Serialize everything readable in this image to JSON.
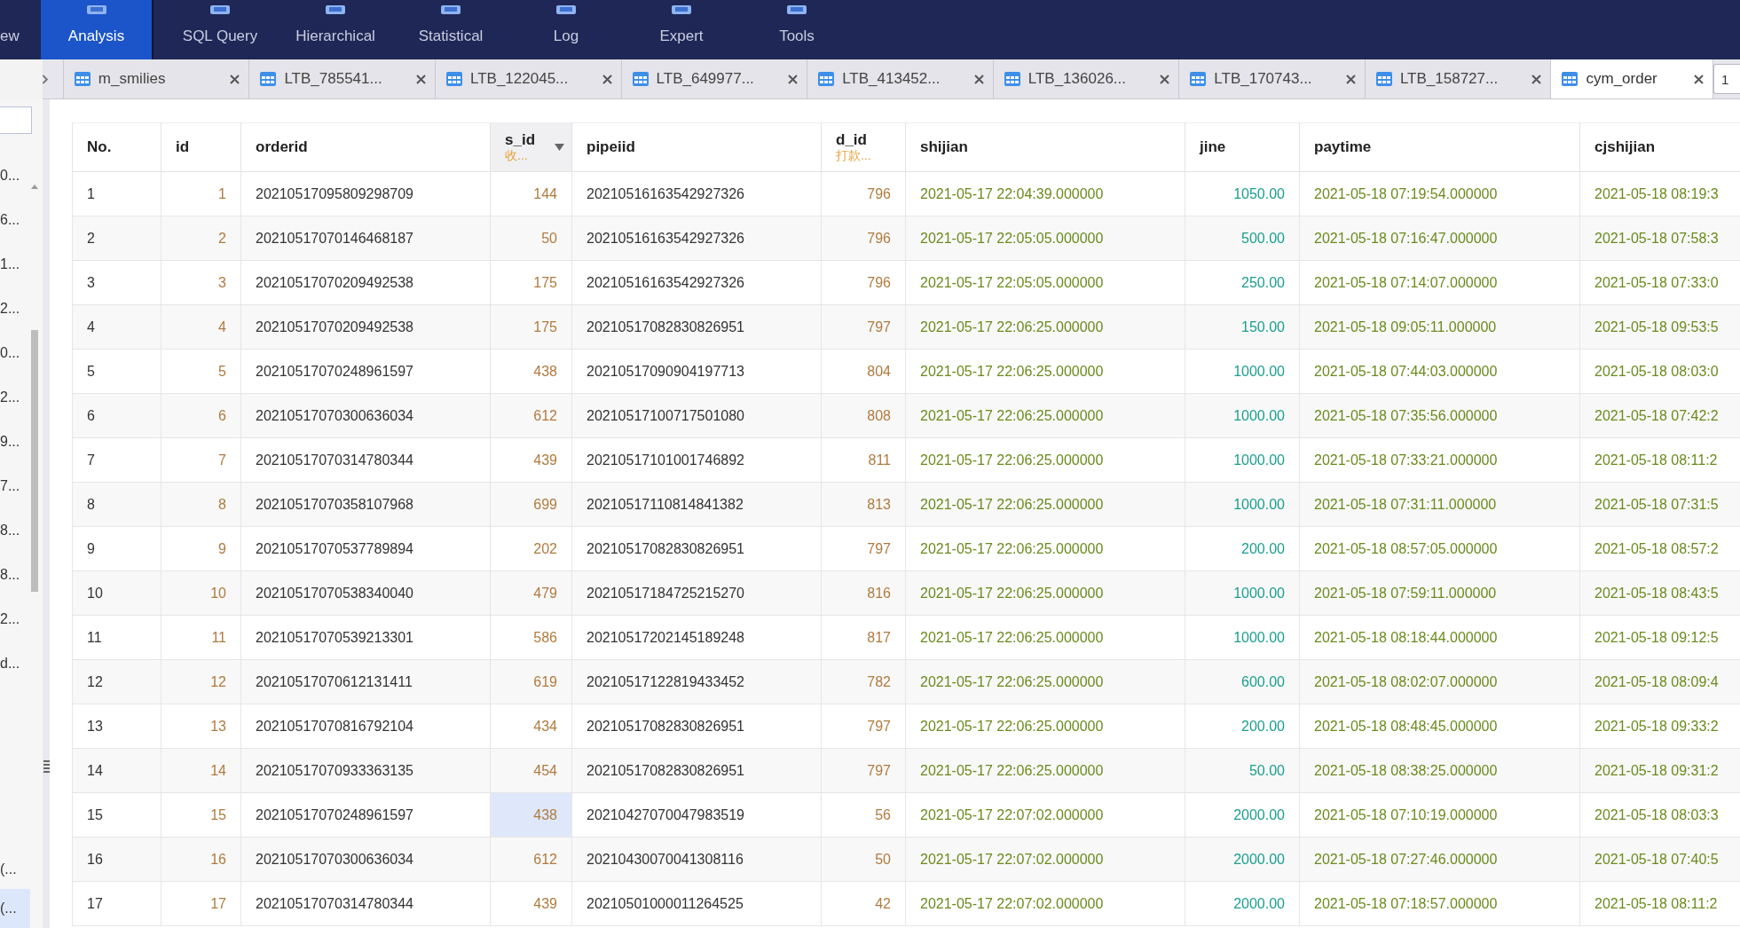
{
  "toolbar": [
    {
      "label": "ew",
      "selected": false,
      "has_icon": false
    },
    {
      "label": "Analysis",
      "selected": true,
      "has_icon": true
    },
    {
      "label": "SQL Query",
      "selected": false,
      "has_icon": true
    },
    {
      "label": "Hierarchical",
      "selected": false,
      "has_icon": true
    },
    {
      "label": "Statistical",
      "selected": false,
      "has_icon": true
    },
    {
      "label": "Log",
      "selected": false,
      "has_icon": true
    },
    {
      "label": "Expert",
      "selected": false,
      "has_icon": true
    },
    {
      "label": "Tools",
      "selected": false,
      "has_icon": true
    }
  ],
  "tabs": [
    {
      "label": "m_smilies",
      "selected": false
    },
    {
      "label": "LTB_785541...",
      "selected": false
    },
    {
      "label": "LTB_122045...",
      "selected": false
    },
    {
      "label": "LTB_649977...",
      "selected": false
    },
    {
      "label": "LTB_413452...",
      "selected": false
    },
    {
      "label": "LTB_136026...",
      "selected": false
    },
    {
      "label": "LTB_170743...",
      "selected": false
    },
    {
      "label": "LTB_158727...",
      "selected": false
    },
    {
      "label": "cym_order",
      "selected": true
    }
  ],
  "page_field": {
    "value": "1"
  },
  "sidebar": {
    "upper_items": [
      {
        "label": "0...",
        "selected": false
      },
      {
        "label": "6...",
        "selected": false
      },
      {
        "label": "1...",
        "selected": false
      },
      {
        "label": "2...",
        "selected": false
      },
      {
        "label": "0...",
        "selected": false
      },
      {
        "label": "2...",
        "selected": false
      },
      {
        "label": "9...",
        "selected": false
      },
      {
        "label": "7...",
        "selected": false
      },
      {
        "label": "8...",
        "selected": false
      },
      {
        "label": "8...",
        "selected": false
      },
      {
        "label": "2...",
        "selected": false
      },
      {
        "label": "d...",
        "selected": false
      }
    ],
    "lower_items": [
      {
        "label": "(...",
        "selected": false
      },
      {
        "label": "(...",
        "selected": true
      }
    ]
  },
  "table": {
    "columns": [
      {
        "name": "No.",
        "kind": "rownum",
        "filter": false
      },
      {
        "name": "id",
        "kind": "int",
        "filter": false
      },
      {
        "name": "orderid",
        "kind": "text",
        "filter": false
      },
      {
        "name": "s_id",
        "subtitle": "收...",
        "kind": "int",
        "filter": true
      },
      {
        "name": "pipeiid",
        "kind": "text",
        "filter": false
      },
      {
        "name": "d_id",
        "subtitle": "打款...",
        "kind": "int",
        "filter": false
      },
      {
        "name": "shijian",
        "kind": "time",
        "filter": false
      },
      {
        "name": "jine",
        "kind": "money",
        "filter": false
      },
      {
        "name": "paytime",
        "kind": "time",
        "filter": false
      },
      {
        "name": "cjshijian",
        "kind": "time",
        "filter": false
      }
    ],
    "rows": [
      {
        "cells": [
          "1",
          "1",
          "20210517095809298709",
          "144",
          "20210516163542927326",
          "796",
          "2021-05-17 22:04:39.000000",
          "1050.00",
          "2021-05-18 07:19:54.000000",
          "2021-05-18 08:19:3"
        ],
        "selected": [
          false,
          false,
          false,
          false,
          false,
          false,
          false,
          false,
          false,
          false
        ]
      },
      {
        "cells": [
          "2",
          "2",
          "20210517070146468187",
          "50",
          "20210516163542927326",
          "796",
          "2021-05-17 22:05:05.000000",
          "500.00",
          "2021-05-18 07:16:47.000000",
          "2021-05-18 07:58:3"
        ],
        "selected": [
          false,
          false,
          false,
          false,
          false,
          false,
          false,
          false,
          false,
          false
        ]
      },
      {
        "cells": [
          "3",
          "3",
          "20210517070209492538",
          "175",
          "20210516163542927326",
          "796",
          "2021-05-17 22:05:05.000000",
          "250.00",
          "2021-05-18 07:14:07.000000",
          "2021-05-18 07:33:0"
        ],
        "selected": [
          false,
          false,
          false,
          false,
          false,
          false,
          false,
          false,
          false,
          false
        ]
      },
      {
        "cells": [
          "4",
          "4",
          "20210517070209492538",
          "175",
          "20210517082830826951",
          "797",
          "2021-05-17 22:06:25.000000",
          "150.00",
          "2021-05-18 09:05:11.000000",
          "2021-05-18 09:53:5"
        ],
        "selected": [
          false,
          false,
          false,
          false,
          false,
          false,
          false,
          false,
          false,
          false
        ]
      },
      {
        "cells": [
          "5",
          "5",
          "20210517070248961597",
          "438",
          "20210517090904197713",
          "804",
          "2021-05-17 22:06:25.000000",
          "1000.00",
          "2021-05-18 07:44:03.000000",
          "2021-05-18 08:03:0"
        ],
        "selected": [
          false,
          false,
          false,
          false,
          false,
          false,
          false,
          false,
          false,
          false
        ]
      },
      {
        "cells": [
          "6",
          "6",
          "20210517070300636034",
          "612",
          "20210517100717501080",
          "808",
          "2021-05-17 22:06:25.000000",
          "1000.00",
          "2021-05-18 07:35:56.000000",
          "2021-05-18 07:42:2"
        ],
        "selected": [
          false,
          false,
          false,
          false,
          false,
          false,
          false,
          false,
          false,
          false
        ]
      },
      {
        "cells": [
          "7",
          "7",
          "20210517070314780344",
          "439",
          "20210517101001746892",
          "811",
          "2021-05-17 22:06:25.000000",
          "1000.00",
          "2021-05-18 07:33:21.000000",
          "2021-05-18 08:11:2"
        ],
        "selected": [
          false,
          false,
          false,
          false,
          false,
          false,
          false,
          false,
          false,
          false
        ]
      },
      {
        "cells": [
          "8",
          "8",
          "20210517070358107968",
          "699",
          "20210517110814841382",
          "813",
          "2021-05-17 22:06:25.000000",
          "1000.00",
          "2021-05-18 07:31:11.000000",
          "2021-05-18 07:31:5"
        ],
        "selected": [
          false,
          false,
          false,
          false,
          false,
          false,
          false,
          false,
          false,
          false
        ]
      },
      {
        "cells": [
          "9",
          "9",
          "20210517070537789894",
          "202",
          "20210517082830826951",
          "797",
          "2021-05-17 22:06:25.000000",
          "200.00",
          "2021-05-18 08:57:05.000000",
          "2021-05-18 08:57:2"
        ],
        "selected": [
          false,
          false,
          false,
          false,
          false,
          false,
          false,
          false,
          false,
          false
        ]
      },
      {
        "cells": [
          "10",
          "10",
          "20210517070538340040",
          "479",
          "20210517184725215270",
          "816",
          "2021-05-17 22:06:25.000000",
          "1000.00",
          "2021-05-18 07:59:11.000000",
          "2021-05-18 08:43:5"
        ],
        "selected": [
          false,
          false,
          false,
          false,
          false,
          false,
          false,
          false,
          false,
          false
        ]
      },
      {
        "cells": [
          "11",
          "11",
          "20210517070539213301",
          "586",
          "20210517202145189248",
          "817",
          "2021-05-17 22:06:25.000000",
          "1000.00",
          "2021-05-18 08:18:44.000000",
          "2021-05-18 09:12:5"
        ],
        "selected": [
          false,
          false,
          false,
          false,
          false,
          false,
          false,
          false,
          false,
          false
        ]
      },
      {
        "cells": [
          "12",
          "12",
          "20210517070612131411",
          "619",
          "20210517122819433452",
          "782",
          "2021-05-17 22:06:25.000000",
          "600.00",
          "2021-05-18 08:02:07.000000",
          "2021-05-18 08:09:4"
        ],
        "selected": [
          false,
          false,
          false,
          false,
          false,
          false,
          false,
          false,
          false,
          false
        ]
      },
      {
        "cells": [
          "13",
          "13",
          "20210517070816792104",
          "434",
          "20210517082830826951",
          "797",
          "2021-05-17 22:06:25.000000",
          "200.00",
          "2021-05-18 08:48:45.000000",
          "2021-05-18 09:33:2"
        ],
        "selected": [
          false,
          false,
          false,
          false,
          false,
          false,
          false,
          false,
          false,
          false
        ]
      },
      {
        "cells": [
          "14",
          "14",
          "20210517070933363135",
          "454",
          "20210517082830826951",
          "797",
          "2021-05-17 22:06:25.000000",
          "50.00",
          "2021-05-18 08:38:25.000000",
          "2021-05-18 09:31:2"
        ],
        "selected": [
          false,
          false,
          false,
          false,
          false,
          false,
          false,
          false,
          false,
          false
        ]
      },
      {
        "cells": [
          "15",
          "15",
          "20210517070248961597",
          "438",
          "20210427070047983519",
          "56",
          "2021-05-17 22:07:02.000000",
          "2000.00",
          "2021-05-18 07:10:19.000000",
          "2021-05-18 08:03:3"
        ],
        "selected": [
          false,
          false,
          false,
          true,
          false,
          false,
          false,
          false,
          false,
          false
        ]
      },
      {
        "cells": [
          "16",
          "16",
          "20210517070300636034",
          "612",
          "20210430070041308116",
          "50",
          "2021-05-17 22:07:02.000000",
          "2000.00",
          "2021-05-18 07:27:46.000000",
          "2021-05-18 07:40:5"
        ],
        "selected": [
          false,
          false,
          false,
          false,
          false,
          false,
          false,
          false,
          false,
          false
        ]
      },
      {
        "cells": [
          "17",
          "17",
          "20210517070314780344",
          "439",
          "20210501000011264525",
          "42",
          "2021-05-17 22:07:02.000000",
          "2000.00",
          "2021-05-18 07:18:57.000000",
          "2021-05-18 08:11:2"
        ],
        "selected": [
          false,
          false,
          false,
          false,
          false,
          false,
          false,
          false,
          false,
          false
        ]
      }
    ]
  }
}
